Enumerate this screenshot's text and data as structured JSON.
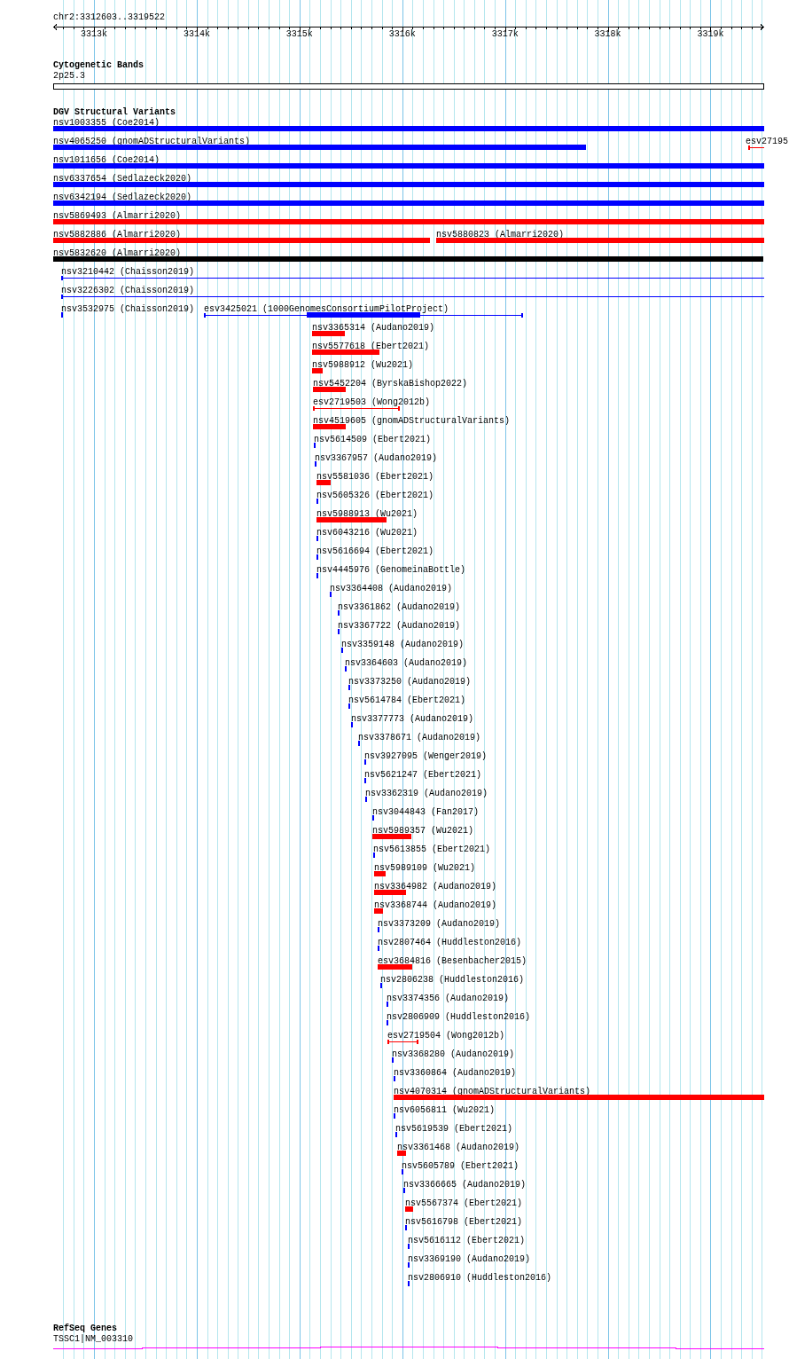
{
  "ruler": {
    "location": "chr2:3312603..3319522",
    "ticks": [
      "3313k",
      "3314k",
      "3315k",
      "3316k",
      "3317k",
      "3318k",
      "3319k"
    ]
  },
  "tracks": [
    {
      "kind": "bands",
      "title": "Cytogenetic Bands",
      "bands": [
        {
          "label": "2p25.3"
        }
      ]
    },
    {
      "kind": "variants",
      "title": "DGV Structural Variants",
      "rows": [
        [
          {
            "label": "nsv1003355 (Coe2014)",
            "kind": "bar",
            "color": "#0000ff"
          }
        ],
        [
          {
            "label": "nsv4065250 (gnomADStructuralVariants)",
            "kind": "bar",
            "color": "#0000ff"
          },
          {
            "label": "esv27195",
            "kind": "line",
            "color": "#ff0000"
          }
        ],
        [
          {
            "label": "nsv1011656 (Coe2014)",
            "kind": "bar",
            "color": "#0000ff"
          }
        ],
        [
          {
            "label": "nsv6337654 (Sedlazeck2020)",
            "kind": "bar",
            "color": "#0000ff"
          }
        ],
        [
          {
            "label": "nsv6342194 (Sedlazeck2020)",
            "kind": "bar",
            "color": "#0000ff"
          }
        ],
        [
          {
            "label": "nsv5869493 (Almarri2020)",
            "kind": "bar",
            "color": "#ff0000"
          }
        ],
        [
          {
            "label": "nsv5882886 (Almarri2020)",
            "kind": "bar",
            "color": "#ff0000"
          },
          {
            "label": "nsv5880823 (Almarri2020)",
            "kind": "bar",
            "color": "#ff0000"
          }
        ],
        [
          {
            "label": "nsv5832620 (Almarri2020)",
            "kind": "bar",
            "color": "#000000"
          }
        ],
        [
          {
            "label": "nsv3210442 (Chaisson2019)",
            "kind": "line",
            "color": "#0000ff"
          }
        ],
        [
          {
            "label": "nsv3226302 (Chaisson2019)",
            "kind": "line",
            "color": "#0000ff"
          }
        ],
        [
          {
            "label": "nsv3532975 (Chaisson2019)",
            "kind": "bar",
            "color": "#0000ff"
          },
          {
            "label": "esv3425021 (1000GenomesConsortiumPilotProject)",
            "kind": "line",
            "color": "#0000ff"
          }
        ],
        [
          {
            "label": "nsv3365314 (Audano2019)",
            "kind": "bar",
            "color": "#ff0000"
          }
        ],
        [
          {
            "label": "nsv5577618 (Ebert2021)",
            "kind": "bar",
            "color": "#ff0000"
          }
        ],
        [
          {
            "label": "nsv5988912 (Wu2021)",
            "kind": "bar",
            "color": "#ff0000"
          }
        ],
        [
          {
            "label": "nsv5452204 (ByrskaBishop2022)",
            "kind": "bar",
            "color": "#ff0000"
          }
        ],
        [
          {
            "label": "esv2719503 (Wong2012b)",
            "kind": "line",
            "color": "#ff0000"
          }
        ],
        [
          {
            "label": "nsv4519605 (gnomADStructuralVariants)",
            "kind": "bar",
            "color": "#ff0000"
          }
        ],
        [
          {
            "label": "nsv5614509 (Ebert2021)",
            "kind": "bar",
            "color": "#0000ff"
          }
        ],
        [
          {
            "label": "nsv3367957 (Audano2019)",
            "kind": "bar",
            "color": "#0000ff"
          }
        ],
        [
          {
            "label": "nsv5581036 (Ebert2021)",
            "kind": "bar",
            "color": "#ff0000"
          }
        ],
        [
          {
            "label": "nsv5605326 (Ebert2021)",
            "kind": "bar",
            "color": "#0000ff"
          }
        ],
        [
          {
            "label": "nsv5988913 (Wu2021)",
            "kind": "bar",
            "color": "#ff0000"
          }
        ],
        [
          {
            "label": "nsv6043216 (Wu2021)",
            "kind": "bar",
            "color": "#0000ff"
          }
        ],
        [
          {
            "label": "nsv5616694 (Ebert2021)",
            "kind": "bar",
            "color": "#0000ff"
          }
        ],
        [
          {
            "label": "nsv4445976 (GenomeinaBottle)",
            "kind": "bar",
            "color": "#0000ff"
          }
        ],
        [
          {
            "label": "nsv3364408 (Audano2019)",
            "kind": "bar",
            "color": "#0000ff"
          }
        ],
        [
          {
            "label": "nsv3361862 (Audano2019)",
            "kind": "bar",
            "color": "#0000ff"
          }
        ],
        [
          {
            "label": "nsv3367722 (Audano2019)",
            "kind": "bar",
            "color": "#0000ff"
          }
        ],
        [
          {
            "label": "nsv3359148 (Audano2019)",
            "kind": "bar",
            "color": "#0000ff"
          }
        ],
        [
          {
            "label": "nsv3364603 (Audano2019)",
            "kind": "bar",
            "color": "#0000ff"
          }
        ],
        [
          {
            "label": "nsv3373250 (Audano2019)",
            "kind": "bar",
            "color": "#0000ff"
          }
        ],
        [
          {
            "label": "nsv5614784 (Ebert2021)",
            "kind": "bar",
            "color": "#0000ff"
          }
        ],
        [
          {
            "label": "nsv3377773 (Audano2019)",
            "kind": "bar",
            "color": "#0000ff"
          }
        ],
        [
          {
            "label": "nsv3378671 (Audano2019)",
            "kind": "bar",
            "color": "#0000ff"
          }
        ],
        [
          {
            "label": "nsv3927095 (Wenger2019)",
            "kind": "bar",
            "color": "#0000ff"
          }
        ],
        [
          {
            "label": "nsv5621247 (Ebert2021)",
            "kind": "bar",
            "color": "#0000ff"
          }
        ],
        [
          {
            "label": "nsv3362319 (Audano2019)",
            "kind": "bar",
            "color": "#0000ff"
          }
        ],
        [
          {
            "label": "nsv3044843 (Fan2017)",
            "kind": "bar",
            "color": "#0000ff"
          }
        ],
        [
          {
            "label": "nsv5989357 (Wu2021)",
            "kind": "bar",
            "color": "#ff0000"
          }
        ],
        [
          {
            "label": "nsv5613855 (Ebert2021)",
            "kind": "bar",
            "color": "#0000ff"
          }
        ],
        [
          {
            "label": "nsv5989109 (Wu2021)",
            "kind": "bar",
            "color": "#ff0000"
          }
        ],
        [
          {
            "label": "nsv3364982 (Audano2019)",
            "kind": "bar",
            "color": "#ff0000"
          }
        ],
        [
          {
            "label": "nsv3368744 (Audano2019)",
            "kind": "bar",
            "color": "#ff0000"
          }
        ],
        [
          {
            "label": "nsv3373209 (Audano2019)",
            "kind": "bar",
            "color": "#0000ff"
          }
        ],
        [
          {
            "label": "nsv2807464 (Huddleston2016)",
            "kind": "bar",
            "color": "#0000ff"
          }
        ],
        [
          {
            "label": "esv3684816 (Besenbacher2015)",
            "kind": "bar",
            "color": "#ff0000"
          }
        ],
        [
          {
            "label": "nsv2806238 (Huddleston2016)",
            "kind": "bar",
            "color": "#0000ff"
          }
        ],
        [
          {
            "label": "nsv3374356 (Audano2019)",
            "kind": "bar",
            "color": "#0000ff"
          }
        ],
        [
          {
            "label": "nsv2806909 (Huddleston2016)",
            "kind": "bar",
            "color": "#0000ff"
          }
        ],
        [
          {
            "label": "esv2719504 (Wong2012b)",
            "kind": "line",
            "color": "#ff0000"
          }
        ],
        [
          {
            "label": "nsv3368280 (Audano2019)",
            "kind": "bar",
            "color": "#0000ff"
          }
        ],
        [
          {
            "label": "nsv3360864 (Audano2019)",
            "kind": "bar",
            "color": "#0000ff"
          }
        ],
        [
          {
            "label": "nsv4070314 (gnomADStructuralVariants)",
            "kind": "bar",
            "color": "#ff0000"
          }
        ],
        [
          {
            "label": "nsv6056811 (Wu2021)",
            "kind": "bar",
            "color": "#0000ff"
          }
        ],
        [
          {
            "label": "nsv5619539 (Ebert2021)",
            "kind": "bar",
            "color": "#0000ff"
          }
        ],
        [
          {
            "label": "nsv3361468 (Audano2019)",
            "kind": "bar",
            "color": "#ff0000"
          }
        ],
        [
          {
            "label": "nsv5605789 (Ebert2021)",
            "kind": "bar",
            "color": "#0000ff"
          }
        ],
        [
          {
            "label": "nsv3366665 (Audano2019)",
            "kind": "bar",
            "color": "#0000ff"
          }
        ],
        [
          {
            "label": "nsv5567374 (Ebert2021)",
            "kind": "bar",
            "color": "#ff0000"
          }
        ],
        [
          {
            "label": "nsv5616798 (Ebert2021)",
            "kind": "bar",
            "color": "#0000ff"
          }
        ],
        [
          {
            "label": "nsv5616112 (Ebert2021)",
            "kind": "bar",
            "color": "#0000ff"
          }
        ],
        [
          {
            "label": "nsv3369190 (Audano2019)",
            "kind": "bar",
            "color": "#0000ff"
          }
        ],
        [
          {
            "label": "nsv2806910 (Huddleston2016)",
            "kind": "bar",
            "color": "#0000ff"
          }
        ]
      ]
    },
    {
      "kind": "genes",
      "title": "RefSeq Genes",
      "genes": [
        {
          "label": "TSSC1|NM_003310",
          "color": "#ff00ff"
        }
      ]
    }
  ]
}
